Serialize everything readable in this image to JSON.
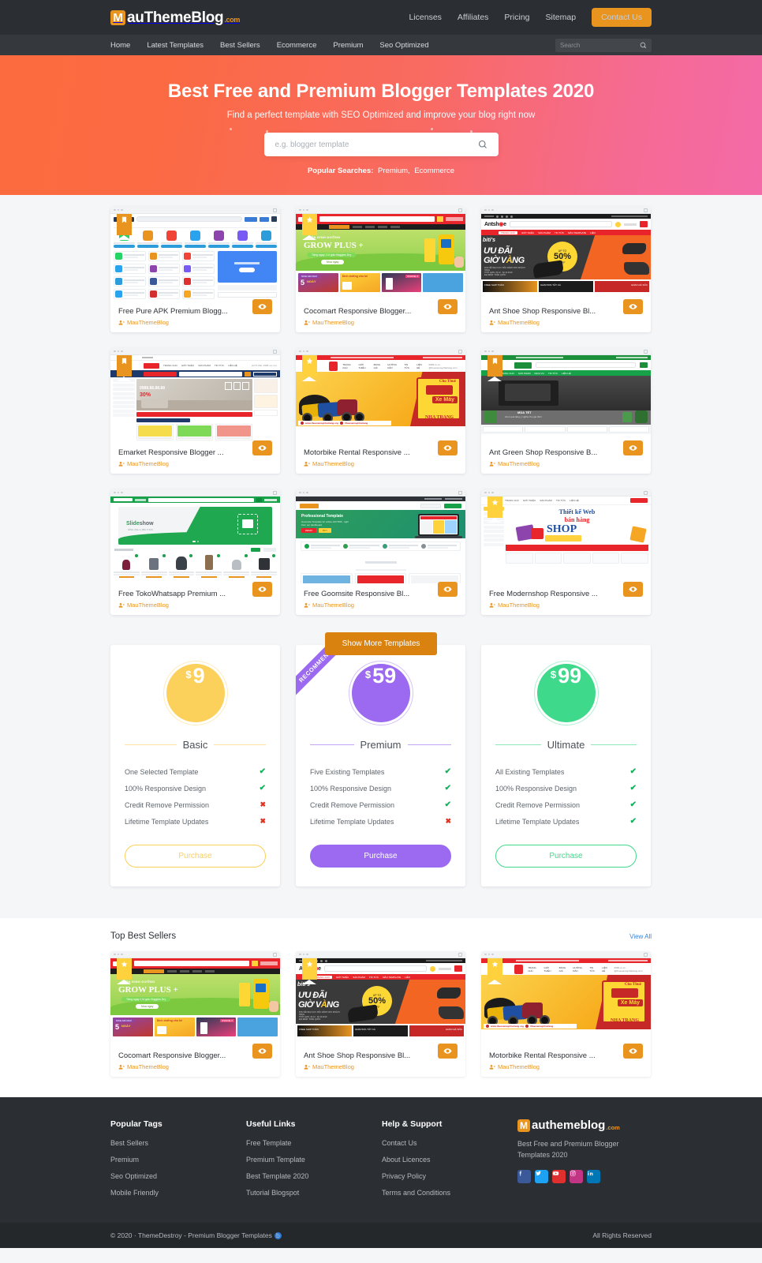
{
  "header": {
    "logo": {
      "badge": "M",
      "text": "auThemeBlog",
      "suffix": ".com"
    },
    "top_links": [
      "Licenses",
      "Affiliates",
      "Pricing",
      "Sitemap"
    ],
    "contact_button": "Contact Us",
    "nav_links": [
      "Home",
      "Latest Templates",
      "Best Sellers",
      "Ecommerce",
      "Premium",
      "Seo Optimized"
    ],
    "search_placeholder": "Search",
    "search_value": ""
  },
  "hero": {
    "title": "Best Free and Premium Blogger Templates 2020",
    "subtitle": "Find a perfect template with SEO Optimized and improve your blog right now",
    "search_placeholder": "e.g. blogger template",
    "search_value": "",
    "popular_label": "Popular Searches:",
    "popular_items": [
      "Premium,",
      "Ecommerce"
    ]
  },
  "templates": [
    {
      "title": "Free Pure APK Premium Blogg...",
      "author": "MauThemeBlog",
      "badge": "bookmark",
      "badge_color": "orange"
    },
    {
      "title": "Cocomart Responsive Blogger...",
      "author": "MauThemeBlog",
      "badge": "star",
      "badge_color": "yellow"
    },
    {
      "title": "Ant Shoe Shop Responsive Bl...",
      "author": "MauThemeBlog",
      "badge": "none",
      "badge_color": ""
    },
    {
      "title": "Emarket Responsive Blogger ...",
      "author": "MauThemeBlog",
      "badge": "bookmark",
      "badge_color": "orange"
    },
    {
      "title": "Motorbike Rental Responsive ...",
      "author": "MauThemeBlog",
      "badge": "star",
      "badge_color": "yellow"
    },
    {
      "title": "Ant Green Shop Responsive B...",
      "author": "MauThemeBlog",
      "badge": "bookmark",
      "badge_color": "orange"
    },
    {
      "title": "Free TokoWhatsapp Premium ...",
      "author": "MauThemeBlog",
      "badge": "none",
      "badge_color": ""
    },
    {
      "title": "Free Goomsite Responsive Bl...",
      "author": "MauThemeBlog",
      "badge": "none",
      "badge_color": ""
    },
    {
      "title": "Free Modernshop Responsive ...",
      "author": "MauThemeBlog",
      "badge": "star",
      "badge_color": "yellow"
    }
  ],
  "show_more_button": "Show More Templates",
  "pricing": {
    "recommend_label": "RECOMMEND",
    "plans": [
      {
        "name": "Basic",
        "currency": "$",
        "price": "9",
        "color": "#fbd05b",
        "style": "outline",
        "purchase_label": "Purchase",
        "features": [
          {
            "label": "One Selected Template",
            "included": true
          },
          {
            "label": "100% Responsive Design",
            "included": true
          },
          {
            "label": "Credit Remove Permission",
            "included": false
          },
          {
            "label": "Lifetime Template Updates",
            "included": false
          }
        ]
      },
      {
        "name": "Premium",
        "currency": "$",
        "price": "59",
        "color": "#9b6af0",
        "style": "filled",
        "purchase_label": "Purchase",
        "features": [
          {
            "label": "Five Existing Templates",
            "included": true
          },
          {
            "label": "100% Responsive Design",
            "included": true
          },
          {
            "label": "Credit Remove Permission",
            "included": true
          },
          {
            "label": "Lifetime Template Updates",
            "included": false
          }
        ]
      },
      {
        "name": "Ultimate",
        "currency": "$",
        "price": "99",
        "color": "#3fd98b",
        "style": "outline",
        "purchase_label": "Purchase",
        "features": [
          {
            "label": "All Existing Templates",
            "included": true
          },
          {
            "label": "100% Responsive Design",
            "included": true
          },
          {
            "label": "Credit Remove Permission",
            "included": true
          },
          {
            "label": "Lifetime Template Updates",
            "included": true
          }
        ]
      }
    ]
  },
  "best_sellers": {
    "title": "Top Best Sellers",
    "view_all": "View All",
    "items": [
      {
        "title": "Cocomart Responsive Blogger...",
        "author": "MauThemeBlog",
        "badge": "star",
        "badge_color": "yellow"
      },
      {
        "title": "Ant Shoe Shop Responsive Bl...",
        "author": "MauThemeBlog",
        "badge": "star",
        "badge_color": "yellow"
      },
      {
        "title": "Motorbike Rental Responsive ...",
        "author": "MauThemeBlog",
        "badge": "star",
        "badge_color": "yellow"
      }
    ]
  },
  "footer": {
    "columns": [
      {
        "heading": "Popular Tags",
        "links": [
          "Best Sellers",
          "Premium",
          "Seo Optimized",
          "Mobile Friendly"
        ]
      },
      {
        "heading": "Useful Links",
        "links": [
          "Free Template",
          "Premium Template",
          "Best Template 2020",
          "Tutorial Blogspot"
        ]
      },
      {
        "heading": "Help & Support",
        "links": [
          "Contact Us",
          "About Licences",
          "Privacy Policy",
          "Terms and Conditions"
        ]
      }
    ],
    "brand": {
      "badge": "M",
      "text": "authemeblog",
      "suffix": ".com"
    },
    "description": "Best Free and Premium Blogger Templates 2020",
    "socials": [
      {
        "name": "facebook-icon",
        "color": "#3b5998"
      },
      {
        "name": "twitter-icon",
        "color": "#1da1f2"
      },
      {
        "name": "youtube-icon",
        "color": "#e02f2f"
      },
      {
        "name": "instagram-icon",
        "color": "#c13584"
      },
      {
        "name": "linkedin-icon",
        "color": "#0077b5"
      }
    ],
    "copyright": "© 2020 · ThemeDestroy - Premium Blogger Templates",
    "rights": "All Rights Reserved"
  },
  "colors": {
    "accent": "#e8941f",
    "dark": "#2b2f33",
    "nav": "#35393d",
    "page_bg": "#f4f6f8"
  }
}
